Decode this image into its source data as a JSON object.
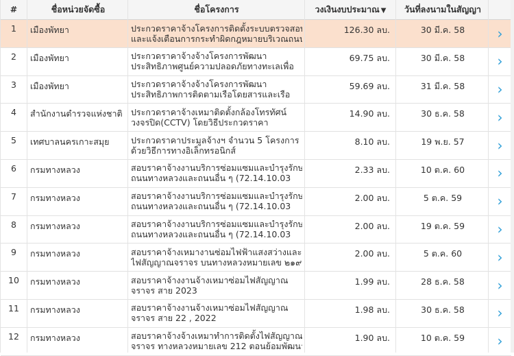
{
  "header": {
    "num": "#",
    "agency": "ชื่อหน่วยจัดซื้อ",
    "project": "ชื่อโครงการ",
    "budget": "วงเงินงบประมาณ",
    "date": "วันที่ลงนามในสัญญา"
  },
  "sort_icon": "sort-desc-icon",
  "arrow_icon": "chevron-right-icon",
  "colors": {
    "highlight": "#fbe0cd",
    "arrow": "#2f9fd8"
  },
  "rows": [
    {
      "num": "1",
      "agency": "เมืองพัทยา",
      "p1": "ประกวดราคาจ้างโครงการติดตั้งระบบตรวจสอบ",
      "p2": "และแจ้งเตือนการกระทำผิดกฎหมายบริเวณถนน",
      "amount": "126.30 ลบ.",
      "date": "30 มี.ค. 58"
    },
    {
      "num": "2",
      "agency": "เมืองพัทยา",
      "p1": "ประกวดราคาจ้างจ้างโครงการพัฒนา",
      "p2": "ประสิทธิภาพศูนย์ความปลอดภัยทางทะเลเพื่อ",
      "amount": "69.75 ลบ.",
      "date": "30 มี.ค. 58"
    },
    {
      "num": "3",
      "agency": "เมืองพัทยา",
      "p1": "ประกวดราคาจ้างจ้างโครงการพัฒนา",
      "p2": "ประสิทธิภาพการติดตามเรือโดยสารและเรือ",
      "amount": "59.69 ลบ.",
      "date": "31 มี.ค. 58"
    },
    {
      "num": "4",
      "agency": "สำนักงานตำรวจแห่งชาติ",
      "p1": "ประกวดราคาจ้างเหมาติดตั้งกล้องโทรทัศน์",
      "p2": "วงจรปิด(CCTV) โดยวิธีประกวดราคา",
      "amount": "14.90 ลบ.",
      "date": "30 ธ.ค. 58"
    },
    {
      "num": "5",
      "agency": "เทศบาลนครเกาะสมุย",
      "p1": "ประกวดราคาประมูลจ้างฯ จำนวน 5 โครงการ",
      "p2": "ด้วยวิธีการทางอิเล็กทรอนิกส์",
      "amount": "8.10 ลบ.",
      "date": "19 พ.ย. 57"
    },
    {
      "num": "6",
      "agency": "กรมทางหลวง",
      "p1": "สอบราคาจ้างงานบริการซ่อมแซมและบำรุงรักษา",
      "p2": "ถนนทางหลวงและถนนอื่น ๆ (72.14.10.03",
      "amount": "2.33 ลบ.",
      "date": "10 ต.ค. 60"
    },
    {
      "num": "7",
      "agency": "กรมทางหลวง",
      "p1": "สอบราคาจ้างงานบริการซ่อมแซมและบำรุงรักษา",
      "p2": "ถนนทางหลวงและถนนอื่น ๆ (72.14.10.03",
      "amount": "2.00 ลบ.",
      "date": "5 ต.ค. 59"
    },
    {
      "num": "8",
      "agency": "กรมทางหลวง",
      "p1": "สอบราคาจ้างงานบริการซ่อมแซมและบำรุงรักษา",
      "p2": "ถนนทางหลวงและถนนอื่น ๆ (72.14.10.03",
      "amount": "2.00 ลบ.",
      "date": "19 ต.ค. 59"
    },
    {
      "num": "9",
      "agency": "กรมทางหลวง",
      "p1": "สอบราคาจ้างเหมางานซ่อมไฟฟ้าแสงสว่างและ",
      "p2": "ไฟสัญญาณจราจร บนทางหลวงหมายเลข ๒๑๙",
      "amount": "2.00 ลบ.",
      "date": "5 ต.ค. 60"
    },
    {
      "num": "10",
      "agency": "กรมทางหลวง",
      "p1": "สอบราคาจ้างงานจ้างเหมาซ่อมไฟสัญญาณ",
      "p2": "จราจร สาย 2023",
      "amount": "1.99 ลบ.",
      "date": "28 ธ.ค. 58"
    },
    {
      "num": "11",
      "agency": "กรมทางหลวง",
      "p1": "สอบราคาจ้างงานจ้างเหมาซ่อมไฟสัญญาณ",
      "p2": "จราจร สาย 22 , 2022",
      "amount": "1.98 ลบ.",
      "date": "30 ธ.ค. 58"
    },
    {
      "num": "12",
      "agency": "กรมทางหลวง",
      "p1": "สอบราคาจ้างจ้างเหมาทำการติดตั้งไฟสัญญาณ",
      "p2": "จราจร ทางหลวงหมายเลข 212 ตอนย้อมพัฒนา",
      "amount": "1.90 ลบ.",
      "date": "10 ต.ค. 59"
    }
  ]
}
